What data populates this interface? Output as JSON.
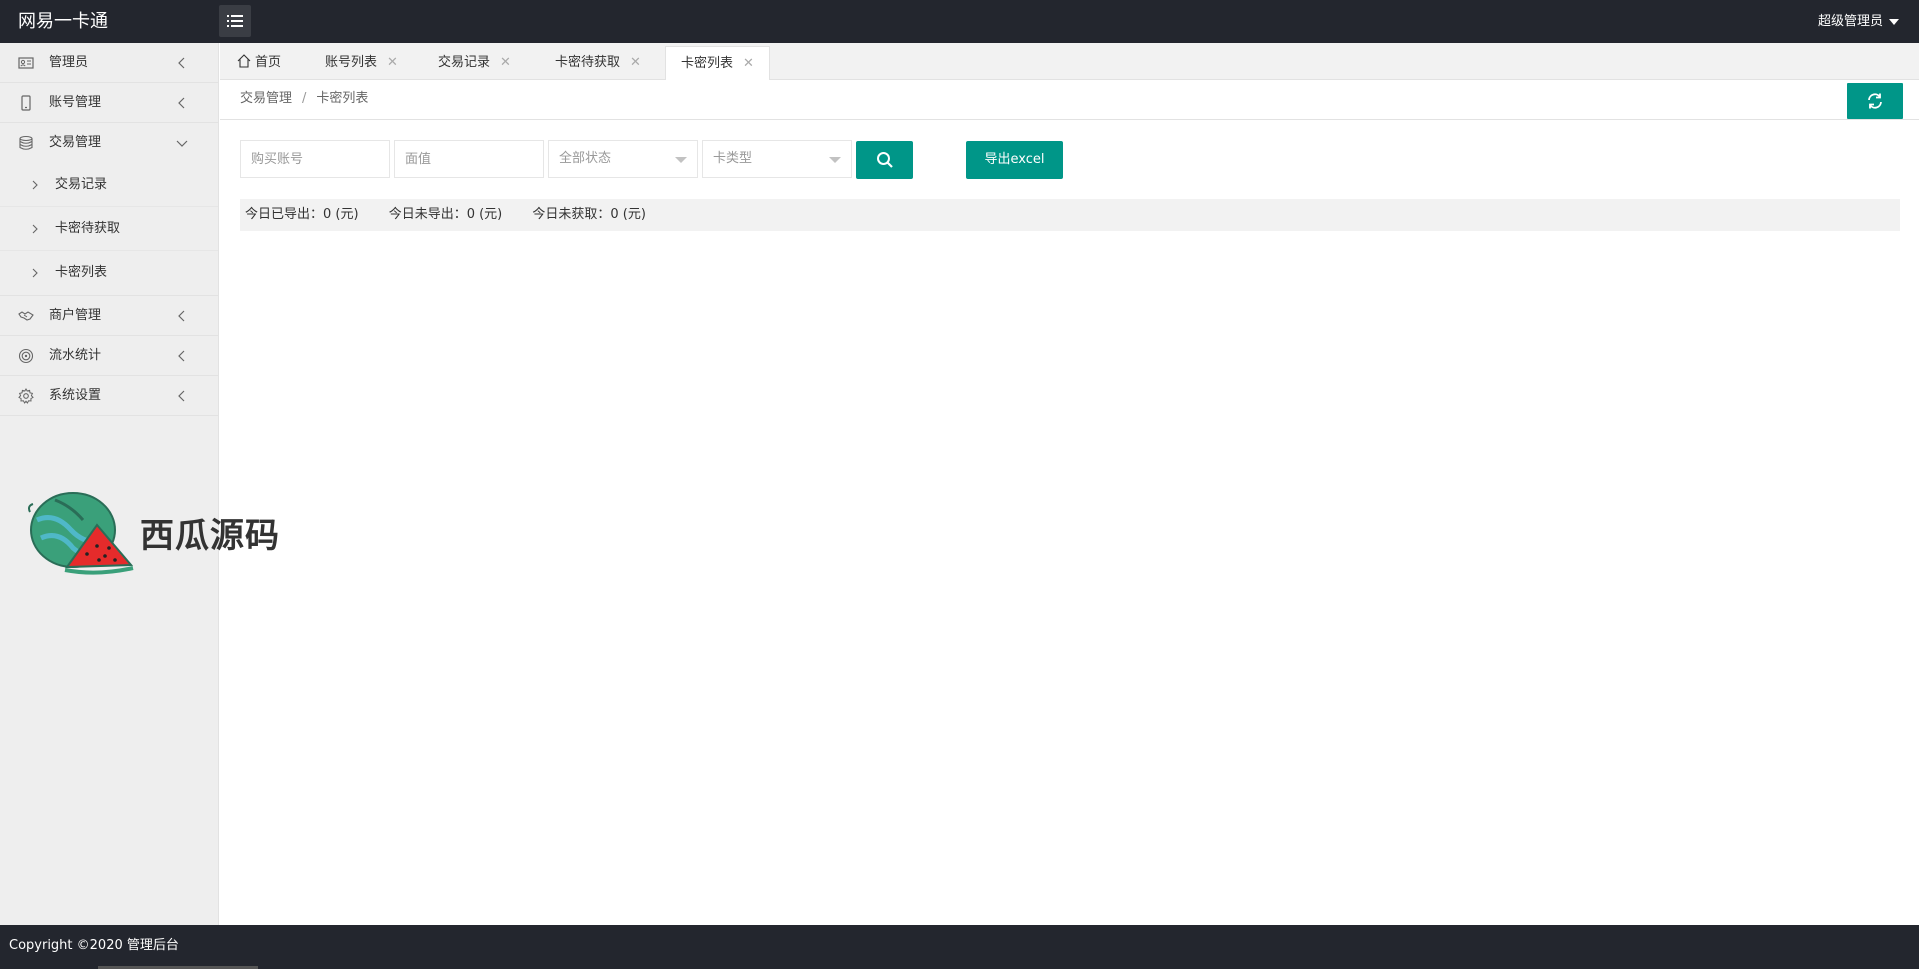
{
  "app": {
    "title": "网易一卡通"
  },
  "header": {
    "user": "超级管理员"
  },
  "sidebar": {
    "items": [
      {
        "label": "管理员",
        "icon": "id-card-icon"
      },
      {
        "label": "账号管理",
        "icon": "phone-icon"
      },
      {
        "label": "交易管理",
        "icon": "database-icon",
        "expanded": true,
        "children": [
          {
            "label": "交易记录"
          },
          {
            "label": "卡密待获取"
          },
          {
            "label": "卡密列表"
          }
        ]
      },
      {
        "label": "商户管理",
        "icon": "handshake-icon"
      },
      {
        "label": "流水统计",
        "icon": "target-icon"
      },
      {
        "label": "系统设置",
        "icon": "gear-icon"
      }
    ]
  },
  "tabs": [
    {
      "label": "首页",
      "closable": false,
      "active": false
    },
    {
      "label": "账号列表",
      "closable": true,
      "active": false
    },
    {
      "label": "交易记录",
      "closable": true,
      "active": false
    },
    {
      "label": "卡密待获取",
      "closable": true,
      "active": false
    },
    {
      "label": "卡密列表",
      "closable": true,
      "active": true
    }
  ],
  "breadcrumb": {
    "parent": "交易管理",
    "separator": "/",
    "current": "卡密列表"
  },
  "filters": {
    "account_placeholder": "购买账号",
    "value_placeholder": "面值",
    "status_selected": "全部状态",
    "type_selected": "卡类型",
    "export_label": "导出excel"
  },
  "stats": {
    "exported_today": "今日已导出：0 (元)",
    "not_exported_today": "今日未导出：0 (元)",
    "not_fetched_today": "今日未获取：0 (元)"
  },
  "footer": {
    "copyright": "Copyright ©2020 管理后台"
  },
  "watermark": {
    "text": "西瓜源码"
  },
  "colors": {
    "accent": "#009688",
    "topbar": "#23262e",
    "sidebar": "#eeeeee"
  }
}
